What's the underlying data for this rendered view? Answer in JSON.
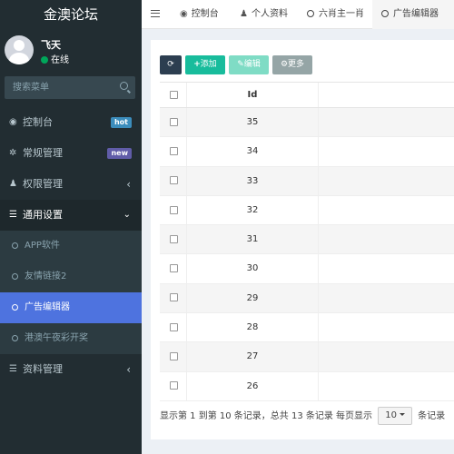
{
  "app": {
    "title": "金澳论坛"
  },
  "user": {
    "name": "飞天",
    "status": "在线"
  },
  "search": {
    "placeholder": "搜索菜单"
  },
  "sidebar": {
    "items": [
      {
        "label": "控制台",
        "icon": "dashboard-icon",
        "badge": "hot",
        "badge_color": "#3c8dbc"
      },
      {
        "label": "常规管理",
        "icon": "cogs-icon",
        "badge": "new",
        "badge_color": "#605ca8"
      },
      {
        "label": "权限管理",
        "icon": "group-icon"
      },
      {
        "label": "通用设置",
        "icon": "list-icon"
      },
      {
        "label": "资料管理",
        "icon": "list-icon"
      }
    ],
    "submenu": [
      {
        "label": "APP软件"
      },
      {
        "label": "友情链接2"
      },
      {
        "label": "广告编辑器"
      },
      {
        "label": "港澳午夜彩开奖"
      }
    ]
  },
  "tabs": [
    {
      "label": "控制台"
    },
    {
      "label": "个人资料"
    },
    {
      "label": "六肖主一肖"
    },
    {
      "label": "广告编辑器"
    }
  ],
  "toolbar": {
    "add_label": "添加",
    "edit_label": "编辑",
    "more_label": "更多"
  },
  "table": {
    "header": {
      "id": "Id"
    },
    "rows": [
      "35",
      "34",
      "33",
      "32",
      "31",
      "30",
      "29",
      "28",
      "27",
      "26"
    ]
  },
  "footer": {
    "summary": "显示第 1 到第 10 条记录，总共 13 条记录 每页显示",
    "page_size": "10",
    "suffix": "条记录"
  }
}
